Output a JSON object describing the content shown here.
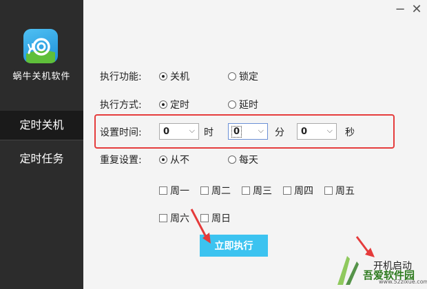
{
  "sidebar": {
    "app_name": "蜗牛关机软件",
    "items": [
      {
        "label": "定时关机",
        "active": true
      },
      {
        "label": "定时任务",
        "active": false
      }
    ]
  },
  "titlebar": {
    "minimize": "−",
    "close": "✕"
  },
  "form": {
    "function": {
      "label": "执行功能:",
      "options": [
        "关机",
        "锁定"
      ],
      "selected": "关机"
    },
    "mode": {
      "label": "执行方式:",
      "options": [
        "定时",
        "延时"
      ],
      "selected": "定时"
    },
    "time": {
      "label": "设置时间:",
      "hour": {
        "value": "0",
        "unit": "时"
      },
      "minute": {
        "value": "0",
        "unit": "分"
      },
      "second": {
        "value": "0",
        "unit": "秒"
      }
    },
    "repeat": {
      "label": "重复设置:",
      "options": [
        "从不",
        "每天"
      ],
      "selected": "从不",
      "weekdays": [
        "周一",
        "周二",
        "周三",
        "周四",
        "周五",
        "周六",
        "周日"
      ]
    }
  },
  "actions": {
    "execute": "立即执行",
    "autostart": "开机启动"
  },
  "watermark": {
    "name": "吾爱软件园",
    "url": "www.52zixue.com"
  },
  "colors": {
    "sidebar": "#2c2c2c",
    "accent": "#3cc3f0",
    "highlight": "#e53b3b"
  }
}
